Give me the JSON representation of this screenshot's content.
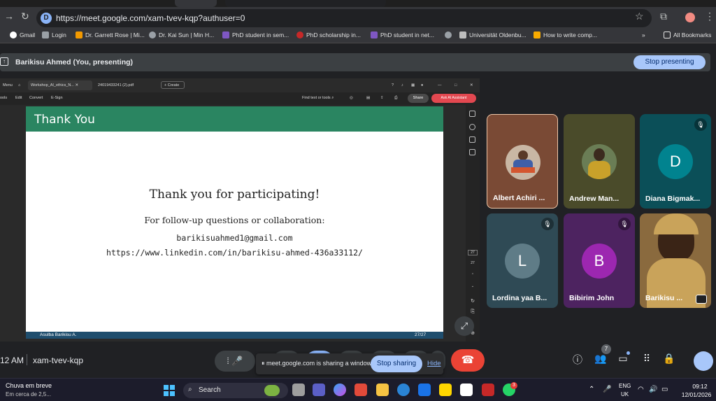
{
  "browser": {
    "url": "https://meet.google.com/xam-tvev-kqp?authuser=0",
    "bookmarks": [
      "Gmail",
      "Login",
      "Dr. Garrett Rose | Mi...",
      "Dr. Kai Sun | Min H...",
      "PhD student in sem...",
      "PhD scholarship in...",
      "PhD student in net...",
      "Universität Oldenbu...",
      "How to write comp..."
    ],
    "all_bookmarks": "All Bookmarks",
    "overflow": "»"
  },
  "presenting": {
    "label": "Barikisu Ahmed (You, presenting)",
    "stop_button": "Stop presenting"
  },
  "pdf": {
    "menu": "Menu",
    "tab_active": "Workshop_AI_ethics_N...",
    "tab_other": "24019433241 (2).pdf",
    "create": "Create",
    "tools": [
      "ools",
      "Edit",
      "Convert",
      "E-Sign"
    ],
    "find": "Find text or tools",
    "share": "Share",
    "ask_ai": "Ask AI Assistant",
    "page_num": "27",
    "page_total": "27"
  },
  "slide": {
    "header": "Thank You",
    "main": "Thank you for participating!",
    "sub": "For follow-up questions or collaboration:",
    "email": "barikisuahmed1@gmail.com",
    "link": "https://www.linkedin.com/in/barikisu-ahmed-436a33112/",
    "footer_author": "Asulba Barikisu A.",
    "footer_page": "27/27"
  },
  "participants": [
    {
      "name": "Albert Achiri ...",
      "initial": "",
      "color": "#7a4a35",
      "muted": false
    },
    {
      "name": "Andrew Man...",
      "initial": "",
      "color": "#4a4b2a",
      "muted": false
    },
    {
      "name": "Diana Bigmak...",
      "initial": "D",
      "color": "#0b4f58",
      "avatar_color": "#01838f",
      "muted": true
    },
    {
      "name": "Lordina yaa B...",
      "initial": "L",
      "color": "#2f4a55",
      "avatar_color": "#5f7c87",
      "muted": true
    },
    {
      "name": "Bibirim John",
      "initial": "B",
      "color": "#4d2360",
      "avatar_color": "#9c27b0",
      "muted": true
    },
    {
      "name": "Barikisu ...",
      "initial": "",
      "color": "#8a6a3e",
      "muted": false
    }
  ],
  "meet": {
    "time": "12 AM",
    "code": "xam-tvev-kqp",
    "share_notice": "meet.google.com is sharing a window.",
    "stop_sharing": "Stop sharing",
    "hide": "Hide",
    "participant_count": "7"
  },
  "taskbar": {
    "weather_title": "Chuva em breve",
    "weather_sub": "Em cerca de 2,5...",
    "search": "Search",
    "lang1": "ENG",
    "lang2": "UK",
    "time": "09:12",
    "date": "12/01/2026",
    "whatsapp_badge": "3"
  }
}
